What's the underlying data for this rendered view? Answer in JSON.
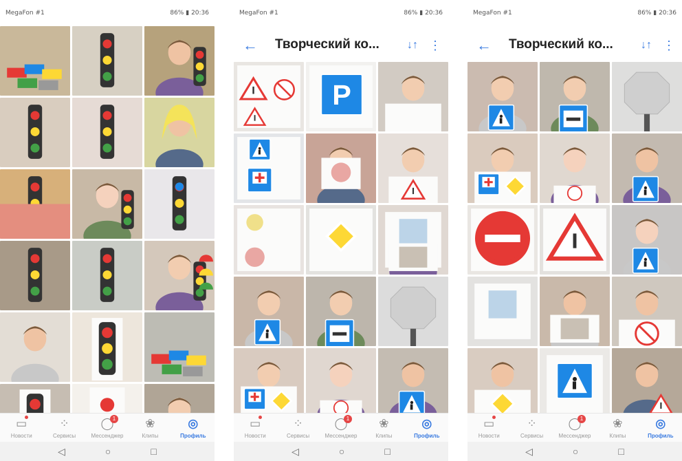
{
  "status": {
    "carrier": "MegaFon #1",
    "battery": "86%",
    "time": "20:36"
  },
  "header": {
    "title": "Творческий ко..."
  },
  "tabs": [
    {
      "label": "Новости",
      "icon": "news-icon",
      "badge": ""
    },
    {
      "label": "Сервисы",
      "icon": "services-icon",
      "badge": ""
    },
    {
      "label": "Мессенджер",
      "icon": "messenger-icon",
      "badge": "1"
    },
    {
      "label": "Клипы",
      "icon": "clips-icon",
      "badge": ""
    },
    {
      "label": "Профиль",
      "icon": "profile-icon",
      "badge": ""
    }
  ],
  "navigation": [
    "back-nav-icon",
    "home-nav-icon",
    "recents-nav-icon"
  ],
  "colors": {
    "accent": "#3a7be0",
    "badge": "#e64646",
    "traffic_red": "#e53935",
    "traffic_yellow": "#fdd835",
    "traffic_green": "#43a047",
    "sign_blue": "#1e88e5"
  },
  "screens": [
    {
      "has_header": false,
      "photos": [
        {
          "subject": "lego-bricks",
          "bg": "#c9b89a"
        },
        {
          "subject": "traffic-light-toy",
          "bg": "#d7d0c3"
        },
        {
          "subject": "child-traffic-light",
          "bg": "#b6a27c"
        },
        {
          "subject": "traffic-light-model",
          "bg": "#d9cdbf"
        },
        {
          "subject": "clay-traffic-light",
          "bg": "#e6dbd5"
        },
        {
          "subject": "girl-yellow-hair",
          "bg": "#d8d6a0"
        },
        {
          "subject": "play-mat-traffic-light",
          "bg": "#d7b07a"
        },
        {
          "subject": "boy-traffic-light",
          "bg": "#c8b9a6"
        },
        {
          "subject": "cloth-traffic-light",
          "bg": "#e9e7ea"
        },
        {
          "subject": "table-traffic-light",
          "bg": "#a89a88"
        },
        {
          "subject": "crosswalk-traffic-light",
          "bg": "#c9ccc6"
        },
        {
          "subject": "girl-traffic-light-craft",
          "bg": "#d4c8bb"
        },
        {
          "subject": "smiling-child",
          "bg": "#e3ddd5"
        },
        {
          "subject": "paper-traffic-light",
          "bg": "#ede6dc"
        },
        {
          "subject": "lego-city",
          "bg": "#bdbcb4"
        },
        {
          "subject": "traffic-light-paper-held",
          "bg": "#c6bdb2"
        },
        {
          "subject": "paper-circles-traffic-light",
          "bg": "#f4f1ec"
        },
        {
          "subject": "boy-lego-police",
          "bg": "#b0a596"
        }
      ]
    },
    {
      "has_header": true,
      "photos": [
        {
          "subject": "warning-signs-drawing",
          "bg": "#e9e6e2"
        },
        {
          "subject": "parking-sign",
          "bg": "#f2f1ef"
        },
        {
          "subject": "girl-drawing",
          "bg": "#d2cbc3"
        },
        {
          "subject": "pedestrian-sign-drawing",
          "bg": "#e3e5e8"
        },
        {
          "subject": "child-red-circle-sign",
          "bg": "#c8a497"
        },
        {
          "subject": "girl-triangle-sign",
          "bg": "#e6dfda"
        },
        {
          "subject": "pencil-signs-drawing",
          "bg": "#e8e3e0"
        },
        {
          "subject": "priority-road-drawing",
          "bg": "#e3e2df"
        },
        {
          "subject": "girl-pale-sign",
          "bg": "#e0d8d2"
        },
        {
          "subject": "boy-crosswalk-sign",
          "bg": "#c9b7a8"
        },
        {
          "subject": "boy-bed-sign",
          "bg": "#bdb6ac"
        },
        {
          "subject": "stop-sign-pencil",
          "bg": "#dcdcdc"
        },
        {
          "subject": "girl-hospital-sign",
          "bg": "#d9cbc0"
        },
        {
          "subject": "girl-stop-sign",
          "bg": "#e0d7d0"
        },
        {
          "subject": "boy-pedestrian-sign",
          "bg": "#c4bcb2"
        }
      ]
    },
    {
      "has_header": true,
      "photos": [
        {
          "subject": "boy-crosswalk-sign",
          "bg": "#cbbbb0"
        },
        {
          "subject": "boy-bed-sign",
          "bg": "#bfb8ad"
        },
        {
          "subject": "stop-sign-pencil",
          "bg": "#dededd"
        },
        {
          "subject": "girl-hospital-sign",
          "bg": "#dacbbe"
        },
        {
          "subject": "girl-stop-sign",
          "bg": "#e0d8d0"
        },
        {
          "subject": "boy-pedestrian-sign",
          "bg": "#c3bab0"
        },
        {
          "subject": "no-entry-sign",
          "bg": "#e9e6e2"
        },
        {
          "subject": "slippery-road-sign",
          "bg": "#e3e1de"
        },
        {
          "subject": "boy-blue-crosswalk-sign",
          "bg": "#c8c6c5"
        },
        {
          "subject": "pale-square-sign",
          "bg": "#e3e2e0"
        },
        {
          "subject": "boy-pale-sign",
          "bg": "#c9b9aa"
        },
        {
          "subject": "boy-no-pedestrian-sign",
          "bg": "#cfc8bf"
        },
        {
          "subject": "girl-yellow-diamond",
          "bg": "#d9ccc1"
        },
        {
          "subject": "crosswalk-sign-drawing",
          "bg": "#ebe9e6"
        },
        {
          "subject": "boy-warning-sign",
          "bg": "#b5a899"
        }
      ]
    }
  ]
}
